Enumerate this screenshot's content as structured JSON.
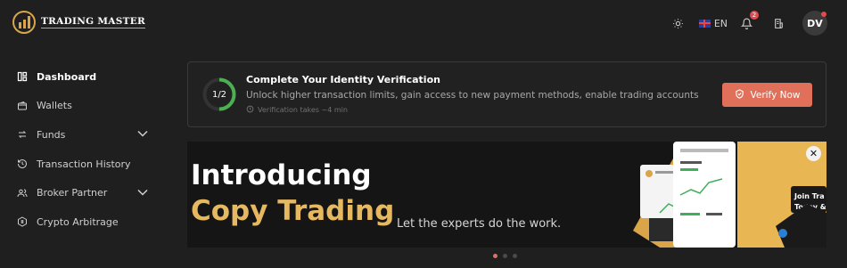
{
  "brand": {
    "name": "TRADING MASTER"
  },
  "topbar": {
    "language": "EN",
    "notification_count": "2",
    "avatar_initials": "DV"
  },
  "sidebar": {
    "items": [
      {
        "label": "Dashboard",
        "icon": "dashboard-icon",
        "active": true
      },
      {
        "label": "Wallets",
        "icon": "wallet-icon"
      },
      {
        "label": "Funds",
        "icon": "transfer-icon",
        "expandable": true
      },
      {
        "label": "Transaction History",
        "icon": "history-icon"
      },
      {
        "label": "Broker Partner",
        "icon": "users-icon",
        "expandable": true
      },
      {
        "label": "Crypto Arbitrage",
        "icon": "crypto-icon"
      }
    ]
  },
  "verification": {
    "progress_label": "1/2",
    "progress_fraction": 0.5,
    "title": "Complete Your Identity Verification",
    "description": "Unlock higher transaction limits, gain access to new payment methods, enable trading accounts",
    "time": "Verification takes ~4 min",
    "button": "Verify Now"
  },
  "banner": {
    "title_line1": "Introducing",
    "title_line2": "Copy Trading",
    "subtitle": "Let the experts do the work.",
    "side_text_1": "Join Tra",
    "side_text_2": "Today &",
    "carousel_active_index": 0,
    "carousel_count": 3
  },
  "colors": {
    "accent": "#e0705a",
    "gold": "#e6b860",
    "progress": "#4caf50"
  }
}
